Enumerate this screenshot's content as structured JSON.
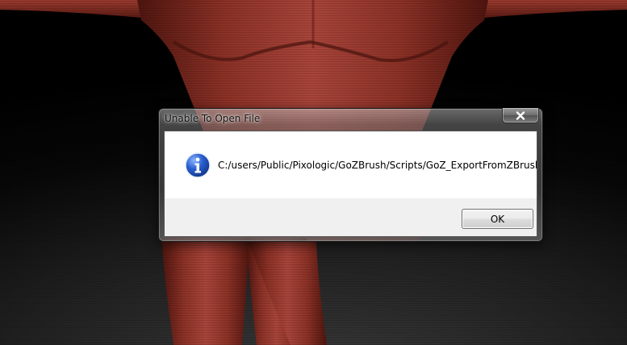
{
  "dialog": {
    "title": "Unable To Open File",
    "message": "C:/users/Public/Pixologic/GoZBrush/Scripts/GoZ_ExportFromZBrush",
    "ok_label": "OK",
    "close_icon": "close-icon",
    "message_icon": "info-icon"
  },
  "colors": {
    "model_base": "#7a2a22",
    "model_highlight": "#b0473a",
    "info_icon_blue": "#1f4fb5",
    "close_glyph": "#ffffff"
  }
}
